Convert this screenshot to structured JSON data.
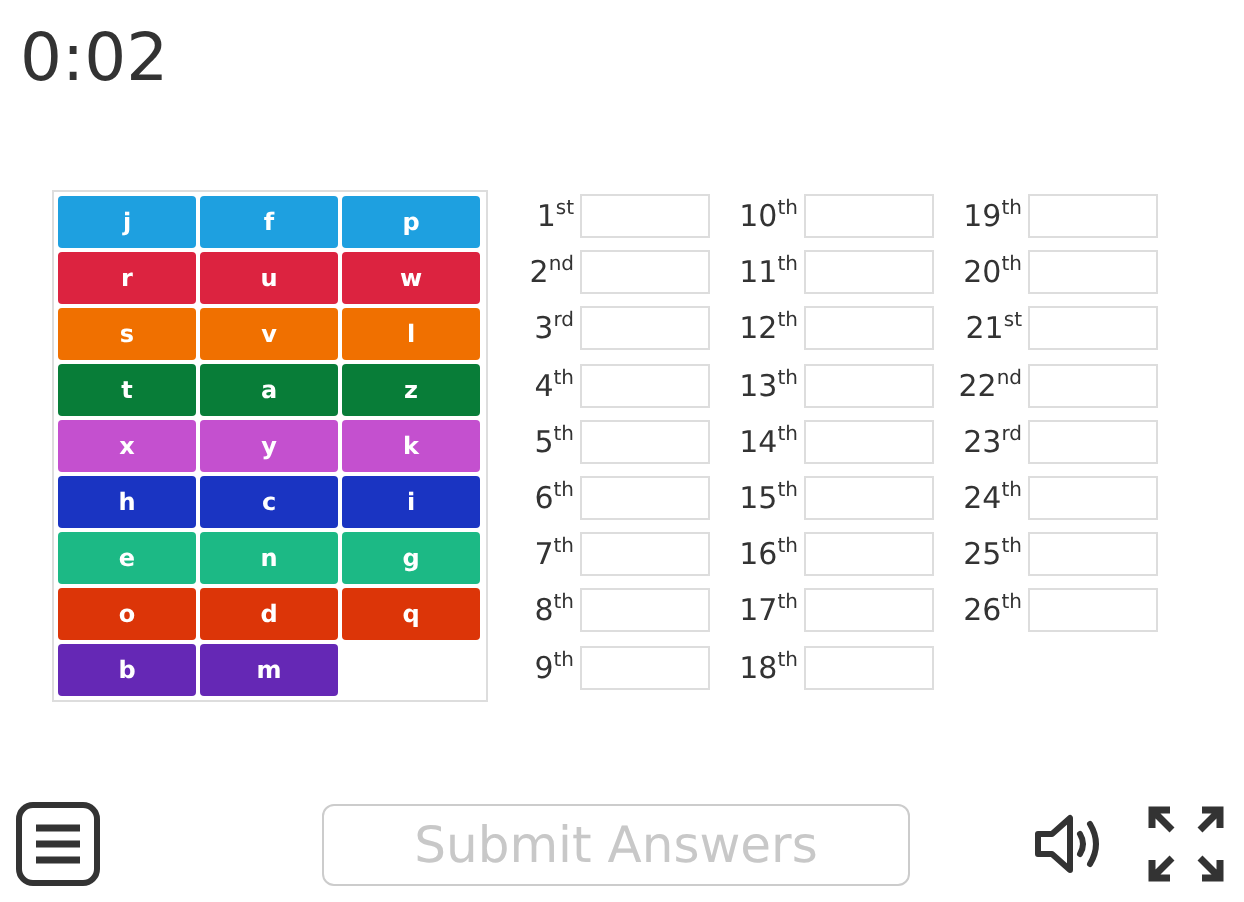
{
  "timer": "0:02",
  "tiles": [
    {
      "letter": "j",
      "color": "#1ea0e0"
    },
    {
      "letter": "f",
      "color": "#1ea0e0"
    },
    {
      "letter": "p",
      "color": "#1ea0e0"
    },
    {
      "letter": "r",
      "color": "#dc2340"
    },
    {
      "letter": "u",
      "color": "#dc2340"
    },
    {
      "letter": "w",
      "color": "#dc2340"
    },
    {
      "letter": "s",
      "color": "#f07000"
    },
    {
      "letter": "v",
      "color": "#f07000"
    },
    {
      "letter": "l",
      "color": "#f07000"
    },
    {
      "letter": "t",
      "color": "#087d38"
    },
    {
      "letter": "a",
      "color": "#087d38"
    },
    {
      "letter": "z",
      "color": "#087d38"
    },
    {
      "letter": "x",
      "color": "#c450cf"
    },
    {
      "letter": "y",
      "color": "#c450cf"
    },
    {
      "letter": "k",
      "color": "#c450cf"
    },
    {
      "letter": "h",
      "color": "#1a34c2"
    },
    {
      "letter": "c",
      "color": "#1a34c2"
    },
    {
      "letter": "i",
      "color": "#1a34c2"
    },
    {
      "letter": "e",
      "color": "#1cb985"
    },
    {
      "letter": "n",
      "color": "#1cb985"
    },
    {
      "letter": "g",
      "color": "#1cb985"
    },
    {
      "letter": "o",
      "color": "#dc3508"
    },
    {
      "letter": "d",
      "color": "#dc3508"
    },
    {
      "letter": "q",
      "color": "#dc3508"
    },
    {
      "letter": "b",
      "color": "#6528b5"
    },
    {
      "letter": "m",
      "color": "#6528b5"
    }
  ],
  "slots": [
    {
      "label": "1$^{st}$"
    },
    {
      "label": "2$^{nd}$"
    },
    {
      "label": "3$^{rd}$"
    },
    {
      "label": "4$^{th}$"
    },
    {
      "label": "5$^{th}$"
    },
    {
      "label": "6$^{th}$"
    },
    {
      "label": "7$^{th}$"
    },
    {
      "label": "8$^{th}$"
    },
    {
      "label": "9$^{th}$"
    },
    {
      "label": "10$^{th}$"
    },
    {
      "label": "11$^{th}$"
    },
    {
      "label": "12$^{th}$"
    },
    {
      "label": "13$^{th}$"
    },
    {
      "label": "14$^{th}$"
    },
    {
      "label": "15$^{th}$"
    },
    {
      "label": "16$^{th}$"
    },
    {
      "label": "17$^{th}$"
    },
    {
      "label": "18$^{th}$"
    },
    {
      "label": "19$^{th}$"
    },
    {
      "label": "20$^{th}$"
    },
    {
      "label": "21$^{st}$"
    },
    {
      "label": "22$^{nd}$"
    },
    {
      "label": "23$^{rd}$"
    },
    {
      "label": "24$^{th}$"
    },
    {
      "label": "25$^{th}$"
    },
    {
      "label": "26$^{th}$"
    }
  ],
  "submit": {
    "label": "Submit Answers",
    "disabled": true
  }
}
